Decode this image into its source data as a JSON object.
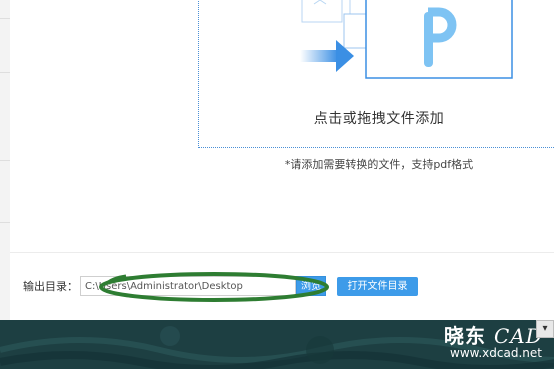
{
  "drop_zone": {
    "hint": "点击或拖拽文件添加",
    "note": "*请添加需要转换的文件，支持pdf格式"
  },
  "output": {
    "label": "输出目录：",
    "path_value": "C:\\Users\\Administrator\\Desktop",
    "browse_label": "浏览",
    "open_folder_label": "打开文件目录"
  },
  "watermark": {
    "logo_text": "晓东",
    "logo_cad": "CAD",
    "url": "www.xdcad.net"
  },
  "colors": {
    "accent": "#3d9be9",
    "pdf_icon": "#7ec3f3",
    "arrow": "#3b8fe4",
    "highlight_ring": "#2e7d32",
    "footer_bg": "#1d3f42"
  }
}
